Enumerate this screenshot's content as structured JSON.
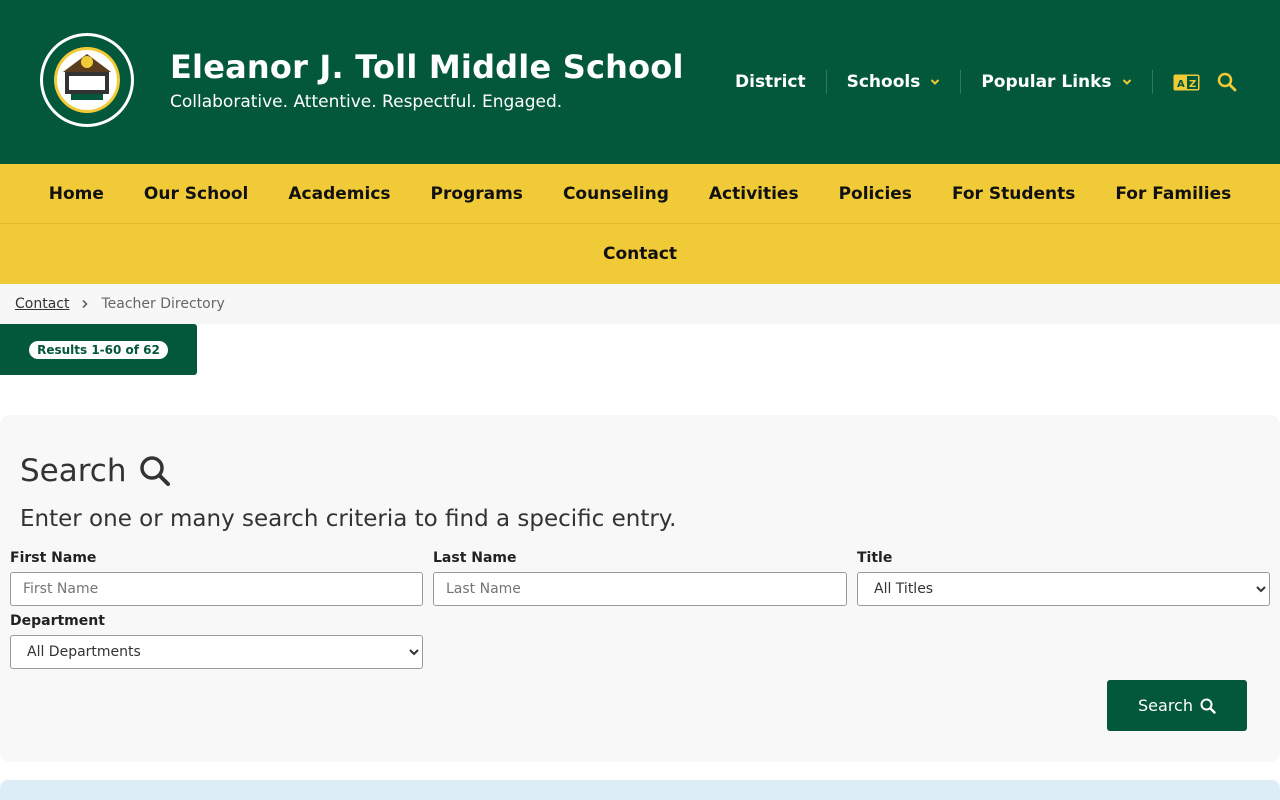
{
  "header": {
    "school_name": "Eleanor J. Toll Middle School",
    "tagline": "Collaborative. Attentive. Respectful. Engaged.",
    "util_nav": {
      "district": "District",
      "schools": "Schools",
      "popular_links": "Popular Links"
    },
    "brand_color": "#03573b",
    "accent_color": "#f1cb37"
  },
  "main_nav": {
    "items": [
      "Home",
      "Our School",
      "Academics",
      "Programs",
      "Counseling",
      "Activities",
      "Policies",
      "For Students",
      "For Families"
    ],
    "contact": "Contact"
  },
  "breadcrumb": {
    "link": "Contact",
    "current": "Teacher Directory"
  },
  "results": {
    "label": "Results 1-60 of 62"
  },
  "search": {
    "heading": "Search",
    "description": "Enter one or many search criteria to find a specific entry.",
    "first_name": {
      "label": "First Name",
      "placeholder": "First Name"
    },
    "last_name": {
      "label": "Last Name",
      "placeholder": "Last Name"
    },
    "title": {
      "label": "Title",
      "selected": "All Titles"
    },
    "department": {
      "label": "Department",
      "selected": "All Departments"
    },
    "button_label": "Search"
  }
}
